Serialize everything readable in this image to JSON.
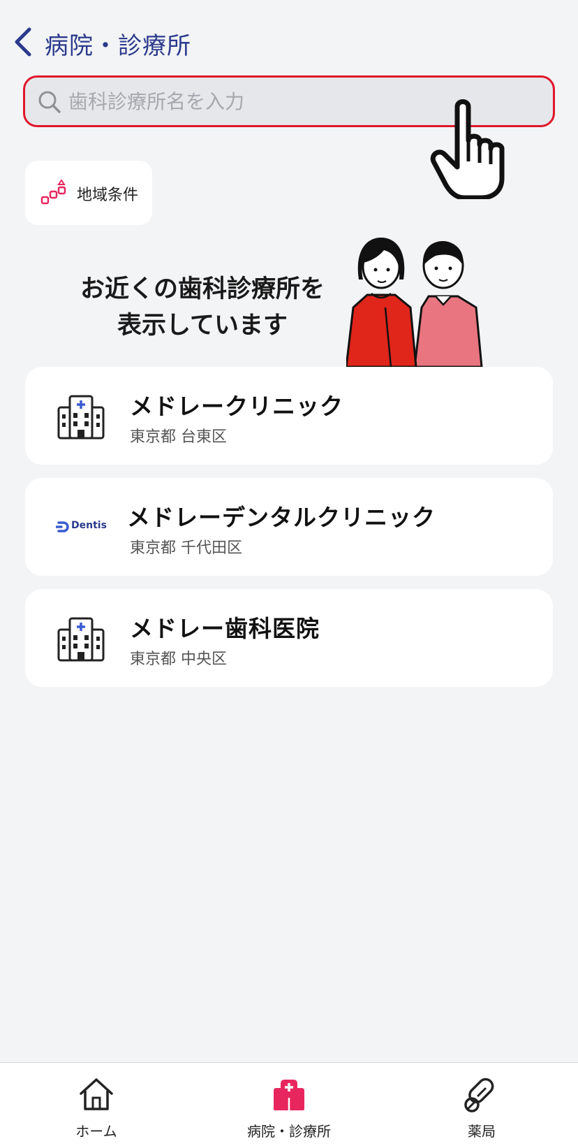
{
  "header": {
    "title": "病院・診療所"
  },
  "search": {
    "placeholder": "歯科診療所名を入力",
    "value": ""
  },
  "filter": {
    "region_label": "地域条件"
  },
  "banner": {
    "line1": "お近くの歯科診療所を",
    "line2": "表示しています"
  },
  "clinics": [
    {
      "name": "メドレークリニック",
      "location": "東京都 台東区",
      "icon": "hospital-building-icon"
    },
    {
      "name": "メドレーデンタルクリニック",
      "location": "東京都 千代田区",
      "icon": "dentis-logo",
      "logo_text": "Dentis"
    },
    {
      "name": "メドレー歯科医院",
      "location": "東京都 中央区",
      "icon": "hospital-building-icon"
    }
  ],
  "tabs": [
    {
      "label": "ホーム",
      "icon": "home-icon",
      "active": false
    },
    {
      "label": "病院・診療所",
      "icon": "hospital-icon",
      "active": true
    },
    {
      "label": "薬局",
      "icon": "pill-icon",
      "active": false
    }
  ],
  "colors": {
    "accent": "#e0162b",
    "brand_navy": "#2b3a8c",
    "active_tab": "#e8265e",
    "background": "#f3f4f6"
  }
}
